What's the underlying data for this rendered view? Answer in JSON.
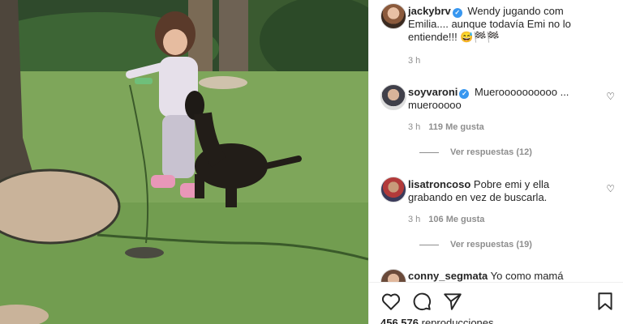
{
  "post": {
    "author": "jackybrv",
    "caption": "Wendy jugando com Emilia.... aunque todavía Emi no lo entiende!!! 😅🏁🏁",
    "time": "3 h"
  },
  "comments": [
    {
      "user": "soyvaroni",
      "verified": true,
      "text": "Mueroooooooooo ... muerooooo",
      "time": "3 h",
      "likes": "119 Me gusta",
      "replies": "Ver respuestas (12)"
    },
    {
      "user": "lisatroncoso",
      "verified": false,
      "text": "Pobre emi y ella grabando en vez de buscarla.",
      "time": "3 h",
      "likes": "106 Me gusta",
      "replies": "Ver respuestas (19)"
    },
    {
      "user": "conny_segmata",
      "verified": false,
      "text": "Yo como mamá"
    }
  ],
  "footer": {
    "views_count": "456.576",
    "views_label": "reproducciones"
  },
  "icons": {
    "heart": "heart-icon",
    "comment": "comment-icon",
    "share": "share-icon",
    "save": "bookmark-icon"
  },
  "colors": {
    "verified": "#3897f0",
    "muted": "#8e8e8e"
  }
}
